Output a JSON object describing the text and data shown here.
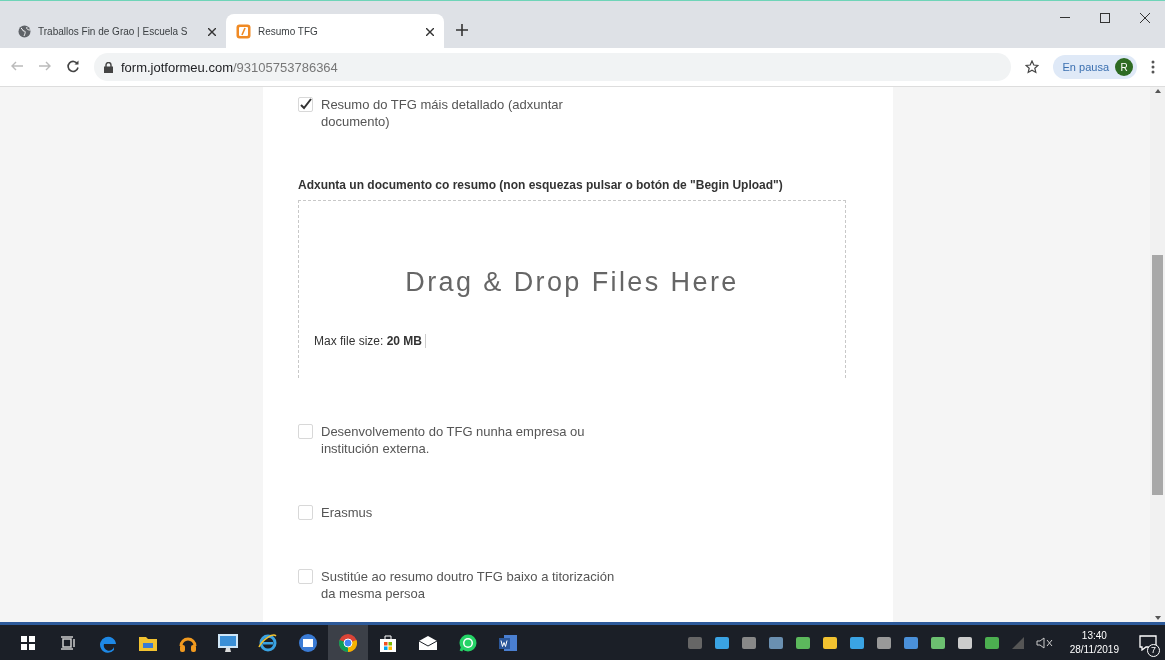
{
  "browser": {
    "tabs": [
      {
        "title": "Traballos Fin de Grao | Escuela S",
        "selected": false
      },
      {
        "title": "Resumo TFG",
        "selected": true
      }
    ],
    "url_host": "form.jotformeu.com",
    "url_path": "/93105753786364",
    "profile_label": "En pausa",
    "profile_initial": "R"
  },
  "form": {
    "items": [
      {
        "kind": "checkbox",
        "label": "Resumo do TFG máis detallado (adxuntar documento)",
        "checked": true
      },
      {
        "kind": "upload",
        "label": "Adxunta un documento co resumo (non esquezas pulsar o botón de \"Begin Upload\")",
        "drop_text": "Drag & Drop Files Here",
        "size_label": "Max file size: **20 MB**"
      },
      {
        "kind": "checkbox",
        "label": "Desenvolvemento do TFG nunha empresa ou institución externa.",
        "checked": false
      },
      {
        "kind": "checkbox",
        "label": "Erasmus",
        "checked": false
      },
      {
        "kind": "checkbox",
        "label": "Sustitúe ao resumo doutro TFG baixo a titorización da mesma persoa",
        "checked": false
      }
    ]
  },
  "taskbar": {
    "clock_time": "13:40",
    "clock_date": "28/11/2019",
    "notification_count": "7"
  }
}
